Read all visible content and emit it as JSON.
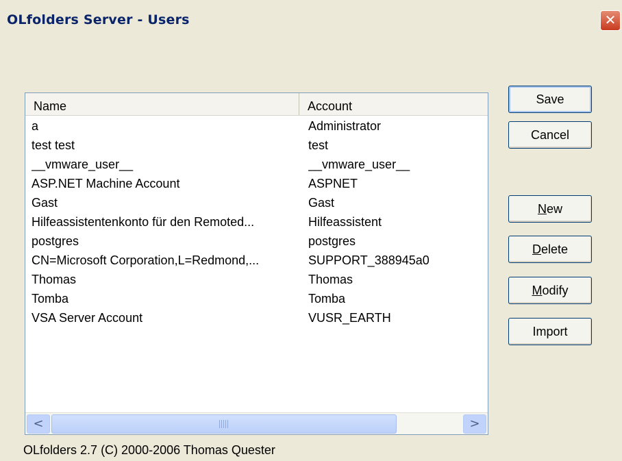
{
  "window": {
    "title": "OLfolders Server - Users",
    "close_symbol": "✕"
  },
  "list": {
    "columns": [
      "Name",
      "Account"
    ],
    "rows": [
      [
        "a",
        "Administrator"
      ],
      [
        "test test",
        "test"
      ],
      [
        "__vmware_user__",
        "__vmware_user__"
      ],
      [
        "ASP.NET Machine Account",
        "ASPNET"
      ],
      [
        "Gast",
        "Gast"
      ],
      [
        "Hilfeassistentenkonto für den Remoted...",
        "Hilfeassistent"
      ],
      [
        "postgres",
        "postgres"
      ],
      [
        "CN=Microsoft Corporation,L=Redmond,...",
        "SUPPORT_388945a0"
      ],
      [
        "Thomas",
        "Thomas"
      ],
      [
        "Tomba",
        "Tomba"
      ],
      [
        "VSA Server Account",
        "VUSR_EARTH"
      ]
    ],
    "scroll_left_symbol": "<",
    "scroll_right_symbol": ">"
  },
  "buttons": {
    "save": "Save",
    "cancel": "Cancel",
    "new_rest": "ew",
    "new_key": "N",
    "delete_key": "D",
    "delete_rest": "elete",
    "modify_key": "M",
    "modify_rest": "odify",
    "import": "Import"
  },
  "status": "OLfolders 2.7 (C) 2000-2006 Thomas Quester",
  "colors": {
    "title_text": "#0a246a",
    "close_button": "#c83b1e",
    "dialog_bg": "#ece9d8"
  }
}
